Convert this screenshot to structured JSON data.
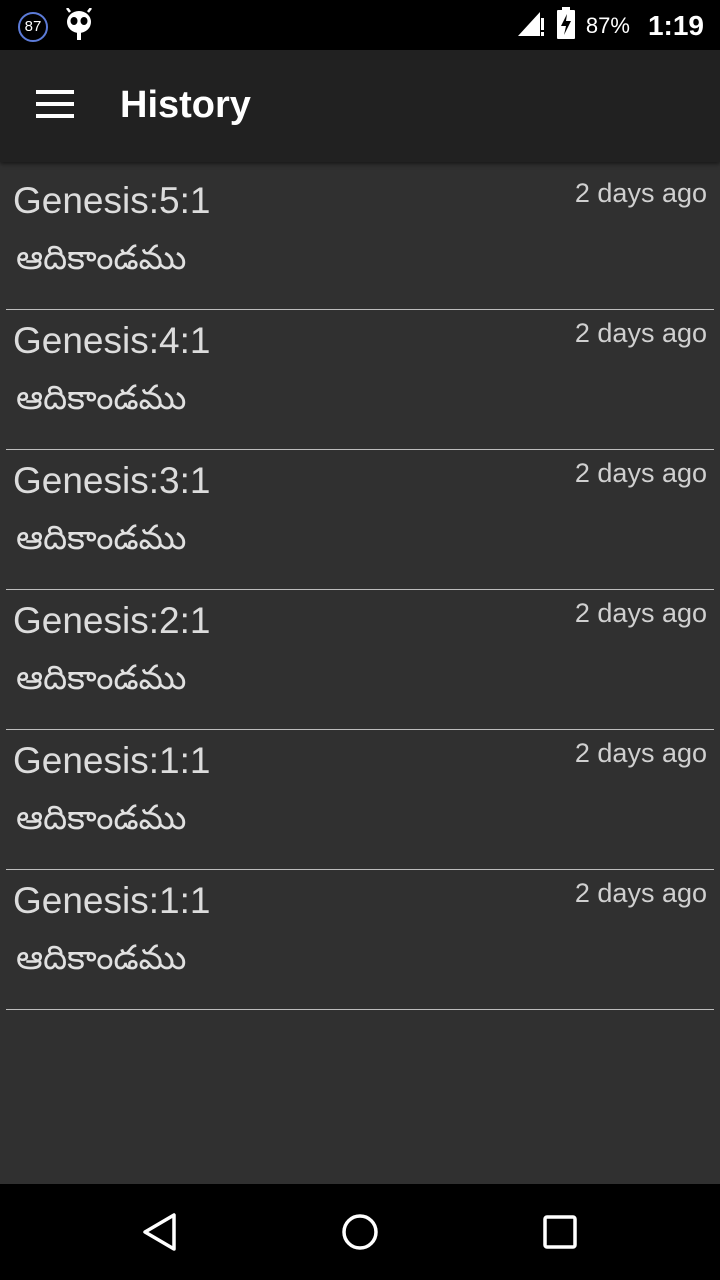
{
  "status_bar": {
    "notification_count": "87",
    "battery_percent": "87%",
    "time": "1:19"
  },
  "app_bar": {
    "title": "History"
  },
  "history": [
    {
      "reference": "Genesis:5:1",
      "book": "ఆదికాండము",
      "time": "2 days ago"
    },
    {
      "reference": "Genesis:4:1",
      "book": "ఆదికాండము",
      "time": "2 days ago"
    },
    {
      "reference": "Genesis:3:1",
      "book": "ఆదికాండము",
      "time": "2 days ago"
    },
    {
      "reference": "Genesis:2:1",
      "book": "ఆదికాండము",
      "time": "2 days ago"
    },
    {
      "reference": "Genesis:1:1",
      "book": "ఆదికాండము",
      "time": "2 days ago"
    },
    {
      "reference": "Genesis:1:1",
      "book": "ఆదికాండము",
      "time": "2 days ago"
    }
  ],
  "icons": {
    "menu": "hamburger-icon",
    "back": "back-triangle-icon",
    "home": "home-circle-icon",
    "recents": "recents-square-icon"
  },
  "colors": {
    "background": "#303030",
    "app_bar": "#212121",
    "status_bar": "#000000"
  }
}
